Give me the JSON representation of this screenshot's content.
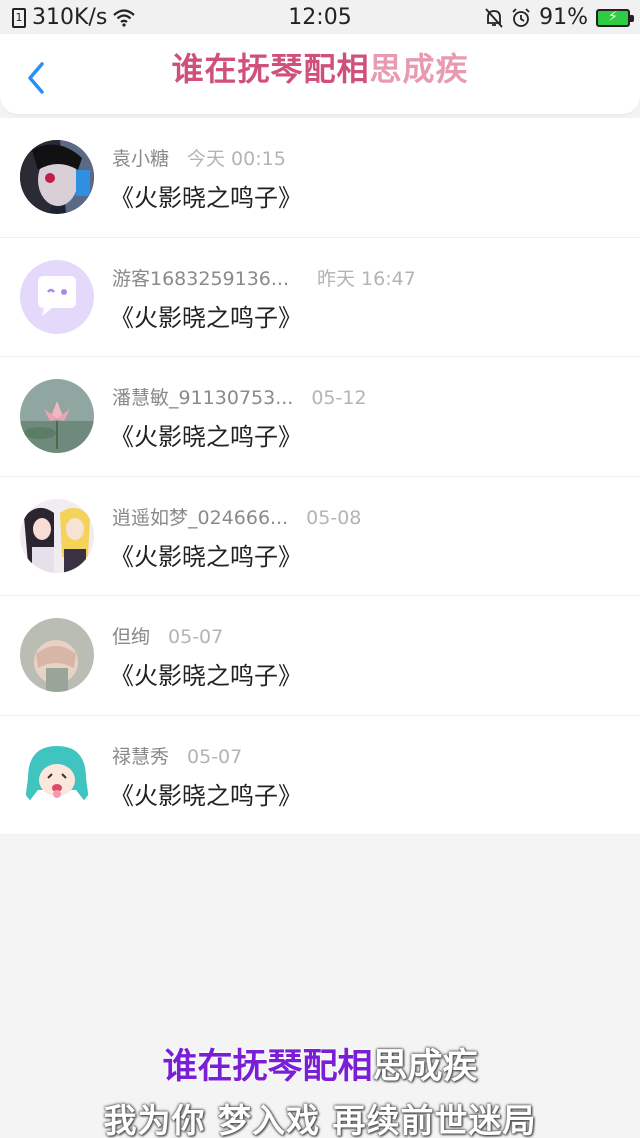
{
  "statusbar": {
    "speed": "310K/s",
    "time": "12:05",
    "battery": "91%"
  },
  "header": {
    "title_sung": "谁在抚琴配相",
    "title_rest": "思成疾"
  },
  "rows": [
    {
      "name": "袁小糖",
      "time": "今天 00:15",
      "message": "《火影晓之鸣子》"
    },
    {
      "name": "游客1683259136...",
      "time": "昨天 16:47",
      "message": "《火影晓之鸣子》"
    },
    {
      "name": "潘慧敏_91130753...",
      "time": "05-12",
      "message": "《火影晓之鸣子》"
    },
    {
      "name": "逍遥如梦_024666...",
      "time": "05-08",
      "message": "《火影晓之鸣子》"
    },
    {
      "name": "但绚",
      "time": "05-07",
      "message": "《火影晓之鸣子》"
    },
    {
      "name": "禄慧秀",
      "time": "05-07",
      "message": "《火影晓之鸣子》"
    }
  ],
  "lyrics": {
    "line1_sung": "谁在抚琴配相",
    "line1_rest": "思成疾",
    "line2": "我为你 梦入戏 再续前世迷局"
  }
}
